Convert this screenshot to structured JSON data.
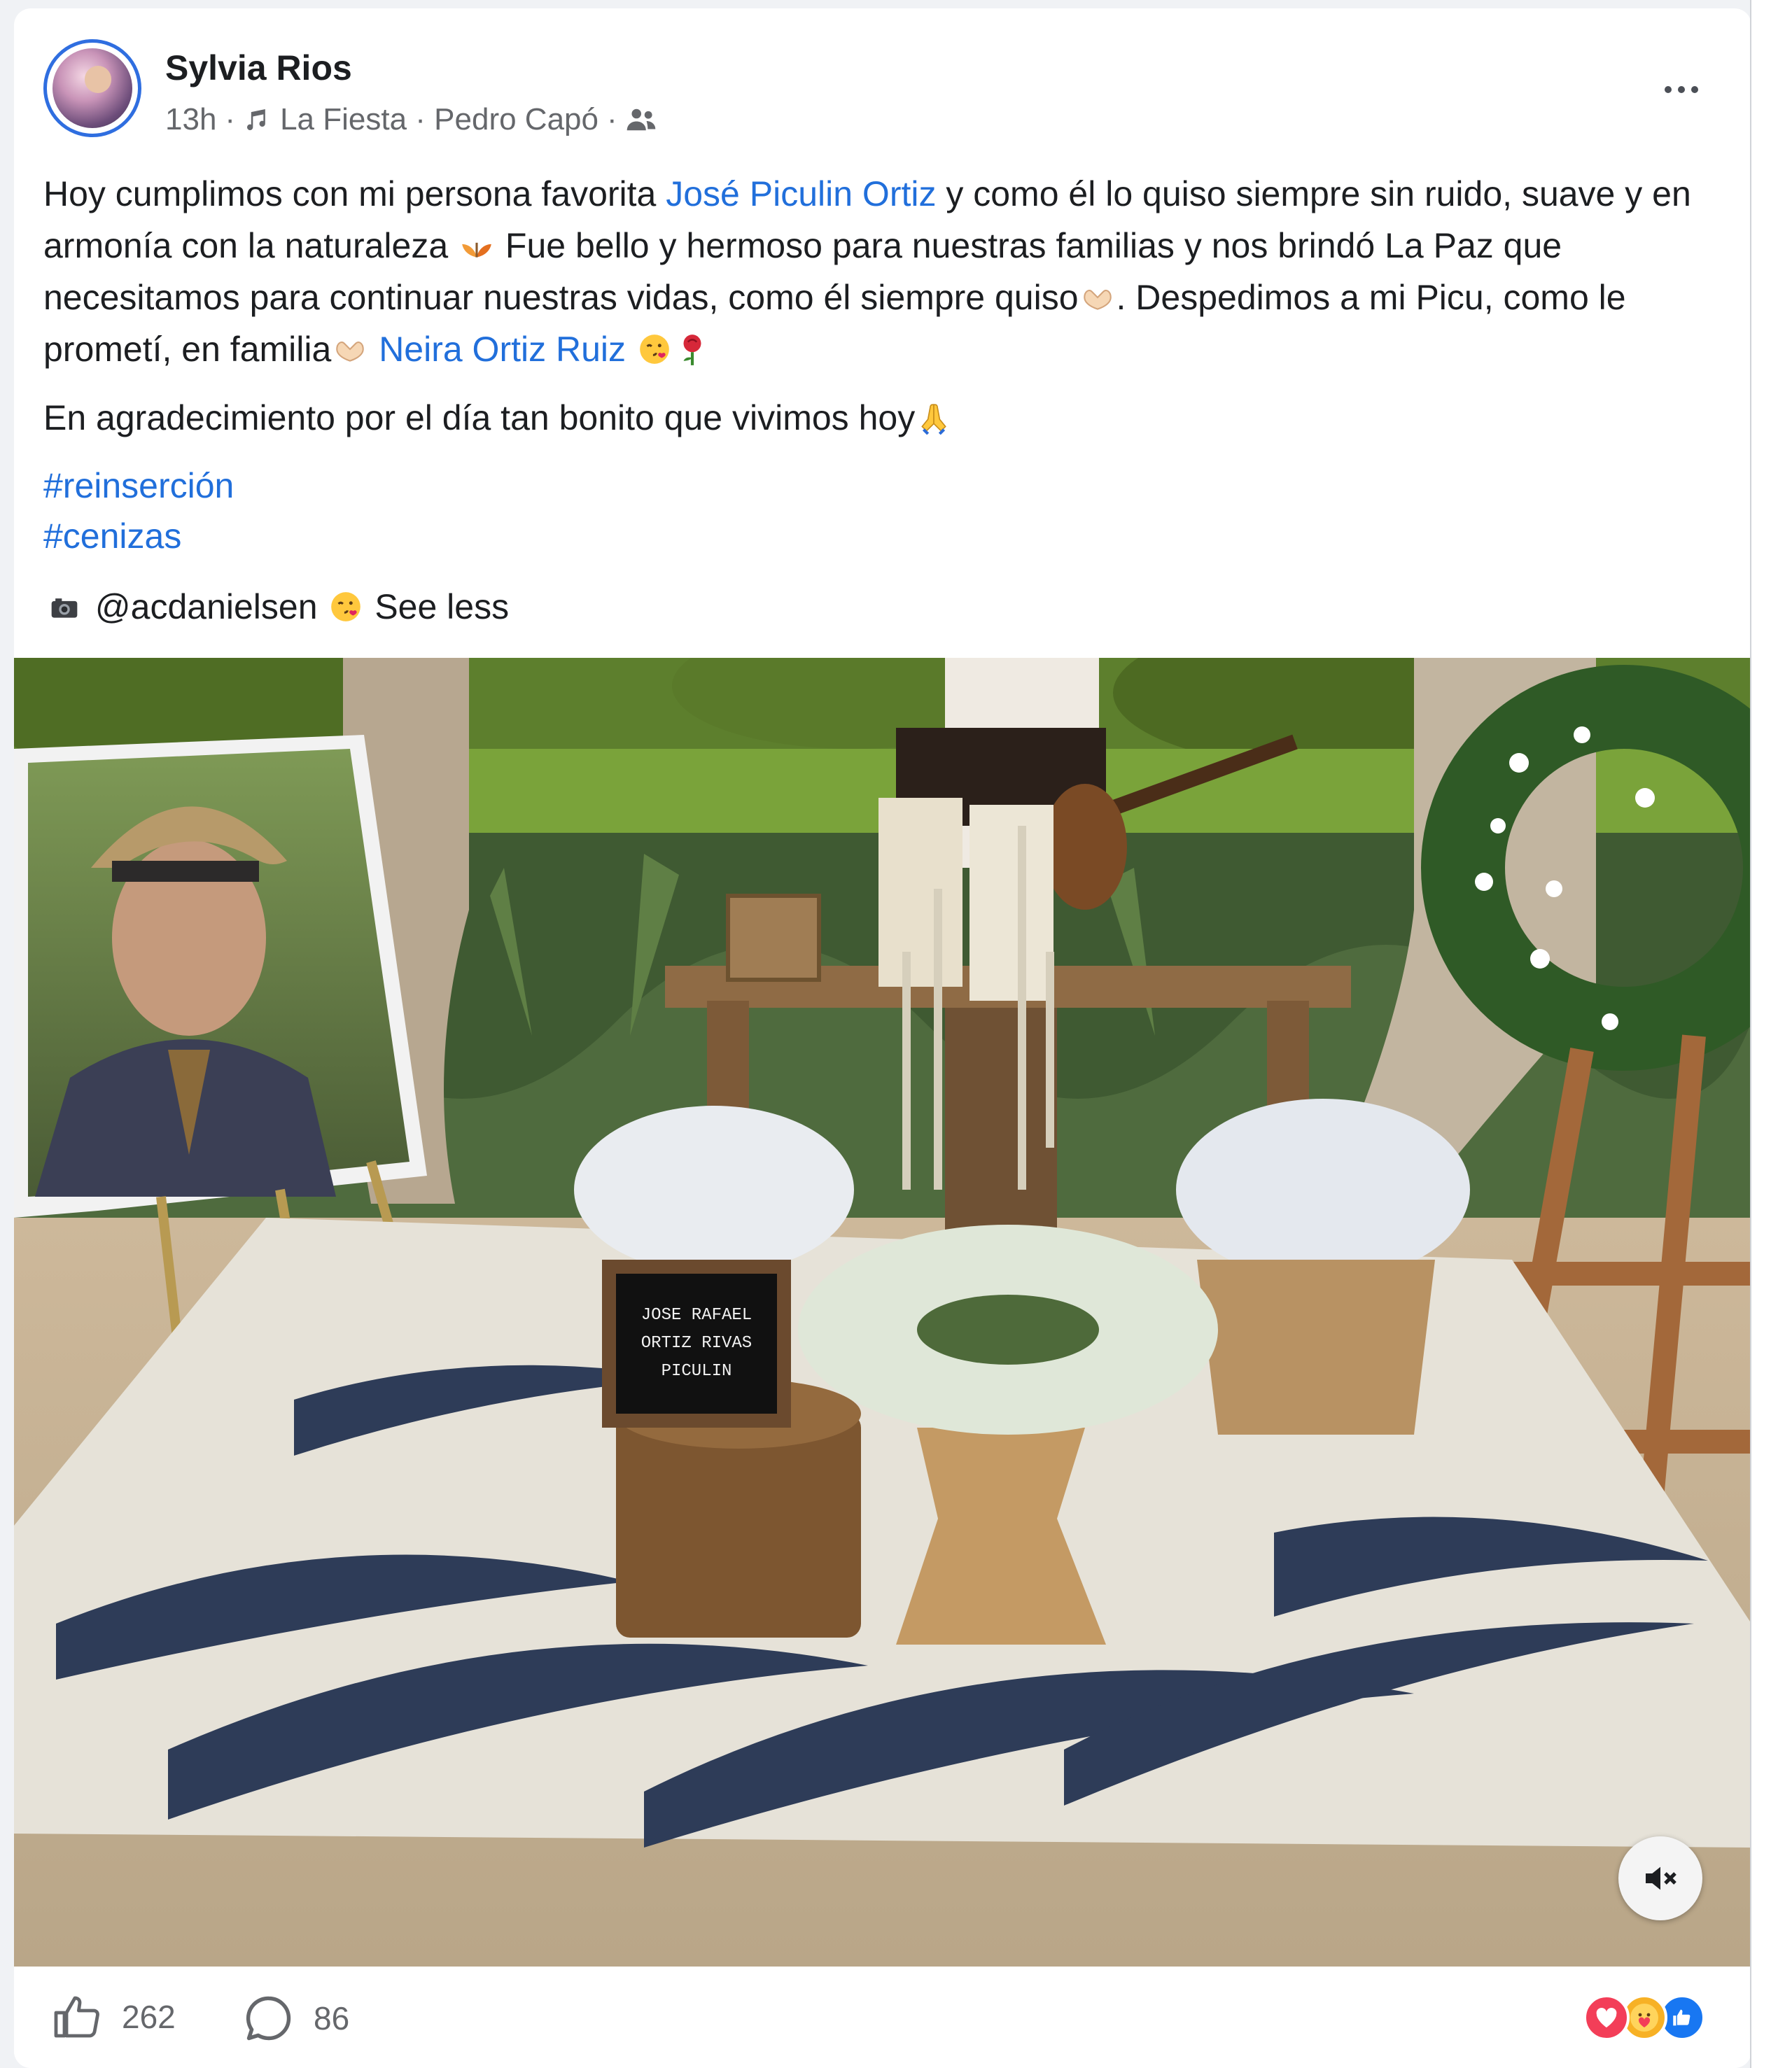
{
  "post": {
    "author": "Sylvia Rios",
    "time": "13h",
    "dot1": "·",
    "music": "La Fiesta · Pedro Capó",
    "dot2": "·",
    "audience_icon": "friends-icon",
    "more_icon": "more-icon"
  },
  "text": {
    "p1_a": "Hoy cumplimos con mi persona favorita ",
    "mention1": "José Piculin Ortiz",
    "p1_b": " y como él lo quiso siempre sin ruido, suave y en armonía con la naturaleza ",
    "p1_c": " Fue bello y hermoso para nuestras familias y nos brindó La Paz que necesitamos para continuar nuestras vidas, como él siempre quiso",
    "p1_d": ".  Despedimos a mi Picu, como le prometí, en familia",
    "mention2": "Neira Ortiz Ruiz",
    "p2": "En agradecimiento por el día tan bonito que vivimos hoy",
    "hashtag1": "#reinserción",
    "hashtag2": "#cenizas",
    "credit": " @acdanielsen ",
    "see_less": "See less"
  },
  "photo": {
    "sign_line1": "JOSE RAFAEL",
    "sign_line2": "ORTIZ RIVAS",
    "sign_line3": "PICULIN",
    "mute_icon": "muted-speaker-icon"
  },
  "footer": {
    "like_count": "262",
    "comment_count": "86",
    "reactions": [
      "love",
      "care",
      "like"
    ]
  },
  "colors": {
    "link": "#216fdb",
    "secondary_text": "#65676b",
    "love": "#f33e58",
    "care": "#f7b125",
    "like": "#1877f2"
  }
}
